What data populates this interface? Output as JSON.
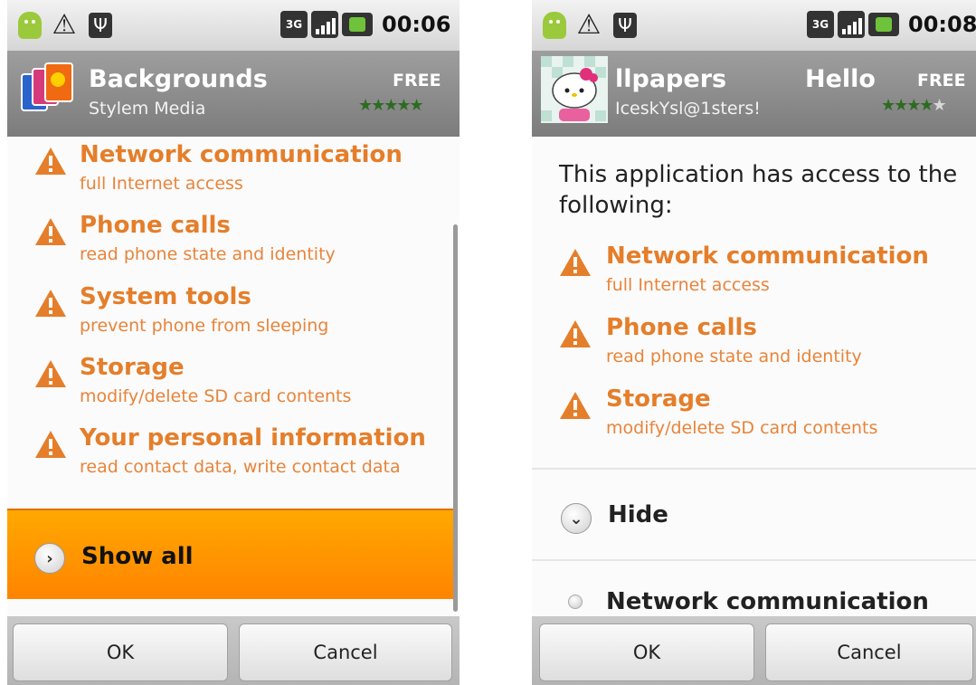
{
  "left_screen": {
    "status_bar": {
      "icons": [
        "android-icon",
        "warning-icon",
        "usb-icon",
        "3g-icon",
        "signal-icon",
        "battery-icon"
      ],
      "network": "3G",
      "time": "00:06"
    },
    "header": {
      "title": "Backgrounds",
      "developer": "Stylem Media",
      "price": "FREE",
      "rating_stars": 5
    },
    "permissions": [
      {
        "title": "Network communication",
        "desc": "full Internet access"
      },
      {
        "title": "Phone calls",
        "desc": "read phone state and identity"
      },
      {
        "title": "System tools",
        "desc": "prevent phone from sleeping"
      },
      {
        "title": "Storage",
        "desc": "modify/delete SD card contents"
      },
      {
        "title": "Your personal information",
        "desc": "read contact data, write contact data"
      }
    ],
    "show_all_label": "Show all",
    "buttons": {
      "ok": "OK",
      "cancel": "Cancel"
    }
  },
  "right_screen": {
    "status_bar": {
      "icons": [
        "android-icon",
        "warning-icon",
        "usb-icon",
        "3g-icon",
        "signal-icon",
        "battery-icon"
      ],
      "network": "3G",
      "time": "00:08"
    },
    "header": {
      "title": "llpapers",
      "title_right": "Hello",
      "developer": "IceskYsl@1sters!",
      "price": "FREE",
      "rating_stars": 4
    },
    "intro": "This application has access to the following:",
    "permissions": [
      {
        "title": "Network communication",
        "desc": "full Internet access"
      },
      {
        "title": "Phone calls",
        "desc": "read phone state and identity"
      },
      {
        "title": "Storage",
        "desc": "modify/delete SD card contents"
      }
    ],
    "hide_label": "Hide",
    "extra_item": "Network communication",
    "buttons": {
      "ok": "OK",
      "cancel": "Cancel"
    }
  },
  "colors": {
    "accent_orange": "#e57e2a",
    "show_all_bg": "#ff9800",
    "header_gray": "#8a8a8a"
  }
}
